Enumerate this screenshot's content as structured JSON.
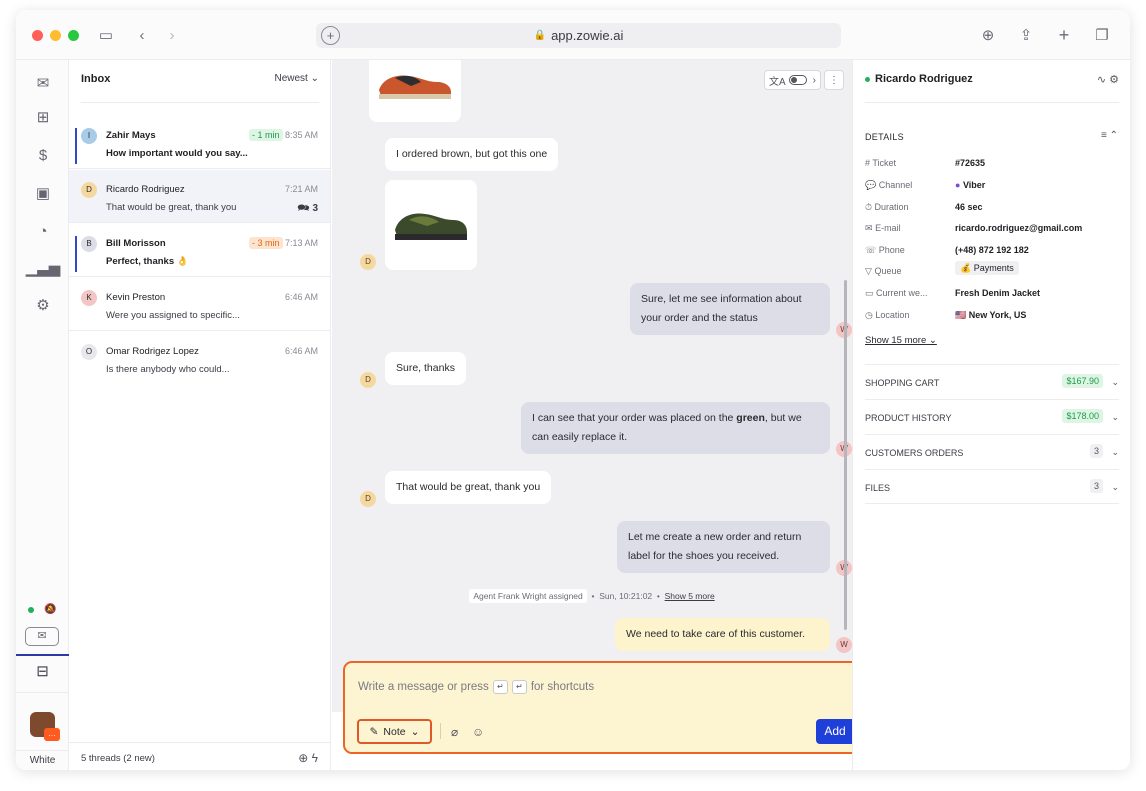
{
  "browser": {
    "url": "app.zowie.ai"
  },
  "rail": {
    "items": [
      "mail-icon",
      "grid-icon",
      "dollar-icon",
      "contact-card-icon",
      "gauge-icon",
      "bar-chart-icon",
      "gear-icon"
    ],
    "workspace_label": "White"
  },
  "inbox": {
    "title": "Inbox",
    "sort": "Newest",
    "threads": [
      {
        "initial": "I",
        "name": "Zahir Mays",
        "sla": "- 1 min",
        "time": "8:35 AM",
        "preview": "How important would you say...",
        "unread": true
      },
      {
        "initial": "D",
        "name": "Ricardo Rodriguez",
        "time": "7:21 AM",
        "preview": "That would be great, thank you",
        "count": "3",
        "active": true
      },
      {
        "initial": "B",
        "name": "Bill Morisson",
        "sla": "- 3 min",
        "time": "7:13 AM",
        "preview": "Perfect, thanks 👌",
        "unread": true
      },
      {
        "initial": "K",
        "name": "Kevin Preston",
        "time": "6:46 AM",
        "preview": "Were you assigned to specific..."
      },
      {
        "initial": "O",
        "name": "Omar Rodrigez Lopez",
        "time": "6:46 AM",
        "preview": "Is there anybody who could..."
      }
    ],
    "footer": "5 threads (2 new)"
  },
  "chat": {
    "messages": {
      "m1": "I ordered brown, but got this one",
      "m2": "Sure, let me see information about your order and the status",
      "m3": "Sure, thanks",
      "m4_pre": "I can see that your order was placed on the ",
      "m4_bold": "green",
      "m4_post": ", but we can easily replace it.",
      "m5": "That would be great, thank you",
      "m6": "Let me create a new order and return label for the shoes you received.",
      "note": "We need to take care of this customer."
    },
    "customer_initial": "D",
    "agent_initial": "W",
    "system": {
      "assigned": "Agent Frank Wright assigned",
      "time": "Sun, 10:21:02",
      "more": "Show 5 more"
    }
  },
  "composer": {
    "placeholder_pre": "Write a message or press",
    "placeholder_post": "for shortcuts",
    "mode": "Note",
    "send": "Add"
  },
  "details": {
    "customer": "Ricardo Rodriguez",
    "section": "DETAILS",
    "rows": [
      {
        "icon": "#",
        "key": "Ticket",
        "value": "#72635"
      },
      {
        "icon": "💬",
        "key": "Channel",
        "value": "Viber"
      },
      {
        "icon": "⏱",
        "key": "Duration",
        "value": "46 sec"
      },
      {
        "icon": "✉",
        "key": "E-mail",
        "value": "ricardo.rodriguez@gmail.com"
      },
      {
        "icon": "☏",
        "key": "Phone",
        "value": "(+48) 872 192 182"
      },
      {
        "icon": "▽",
        "key": "Queue",
        "value": "💰 Payments"
      },
      {
        "icon": "▭",
        "key": "Current we...",
        "value": "Fresh Denim Jacket"
      },
      {
        "icon": "◷",
        "key": "Location",
        "value": "🇺🇸 New York, US"
      }
    ],
    "show_more": "Show 15 more",
    "accordions": [
      {
        "label": "SHOPPING CART",
        "value": "$167.90",
        "green": true
      },
      {
        "label": "PRODUCT HISTORY",
        "value": "$178.00",
        "green": true
      },
      {
        "label": "CUSTOMERS ORDERS",
        "value": "3"
      },
      {
        "label": "FILES",
        "value": "3"
      }
    ]
  },
  "colors": {
    "accent": "#1f3fd9",
    "highlight": "#ee6426",
    "online": "#22b05c",
    "note_bg": "#fdf4d2"
  }
}
